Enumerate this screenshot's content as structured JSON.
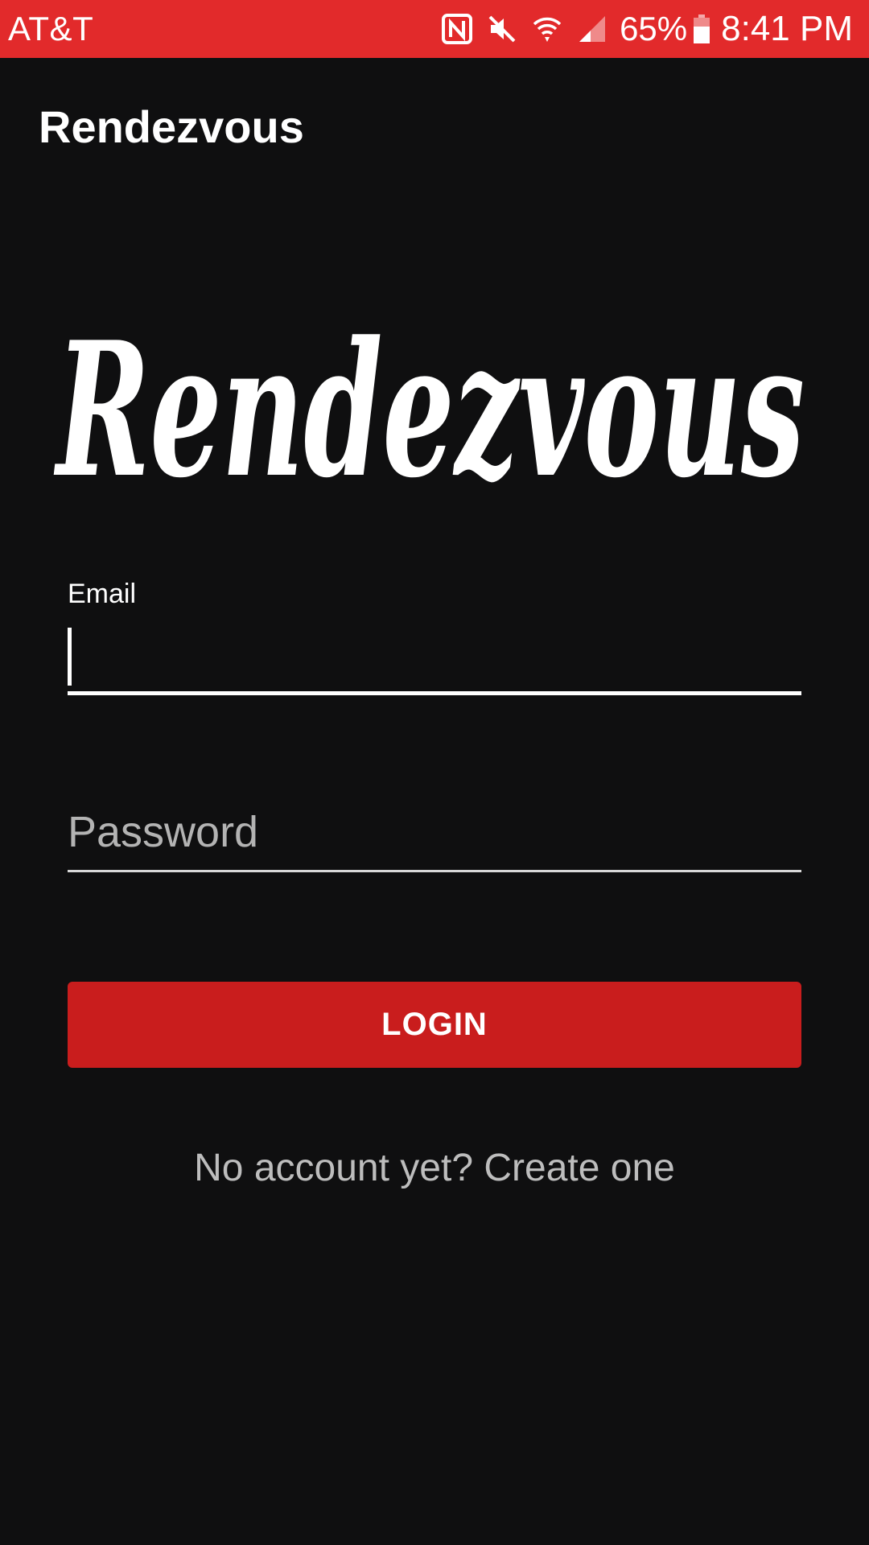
{
  "status_bar": {
    "carrier": "AT&T",
    "battery_percent": "65%",
    "time": "8:41 PM",
    "icons": [
      "nfc-icon",
      "mute-icon",
      "wifi-icon",
      "signal-icon",
      "battery-icon"
    ],
    "background_color": "#e22a2b"
  },
  "app_bar": {
    "title": "Rendezvous"
  },
  "logo": {
    "text": "Rendezvous"
  },
  "form": {
    "email_label": "Email",
    "email_value": "",
    "password_placeholder": "Password",
    "login_label": "LOGIN",
    "create_account_text": "No account yet? Create one"
  },
  "colors": {
    "background": "#0f0f10",
    "accent": "#c91d1d",
    "text": "#ffffff",
    "muted_text": "#bdbdbd"
  }
}
